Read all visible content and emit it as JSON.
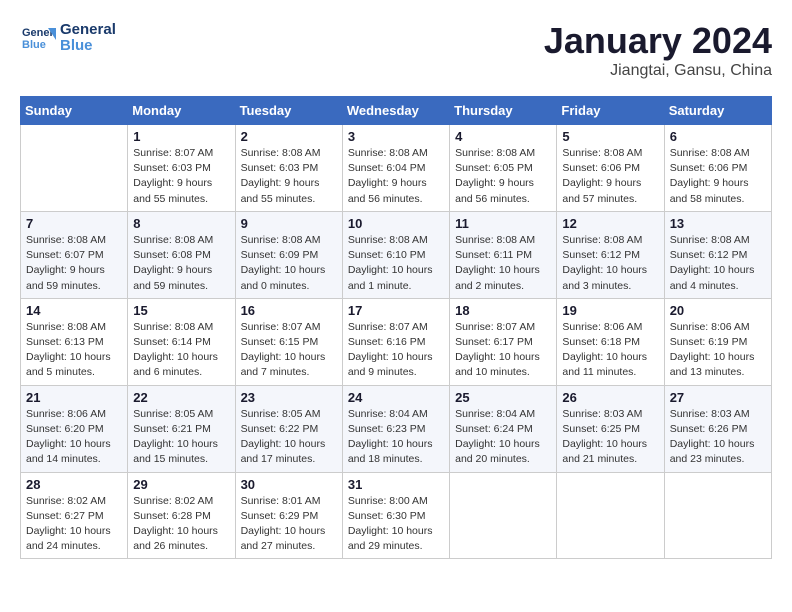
{
  "header": {
    "logo_line1": "General",
    "logo_line2": "Blue",
    "month": "January 2024",
    "location": "Jiangtai, Gansu, China"
  },
  "weekdays": [
    "Sunday",
    "Monday",
    "Tuesday",
    "Wednesday",
    "Thursday",
    "Friday",
    "Saturday"
  ],
  "weeks": [
    [
      {
        "day": "",
        "info": ""
      },
      {
        "day": "1",
        "info": "Sunrise: 8:07 AM\nSunset: 6:03 PM\nDaylight: 9 hours\nand 55 minutes."
      },
      {
        "day": "2",
        "info": "Sunrise: 8:08 AM\nSunset: 6:03 PM\nDaylight: 9 hours\nand 55 minutes."
      },
      {
        "day": "3",
        "info": "Sunrise: 8:08 AM\nSunset: 6:04 PM\nDaylight: 9 hours\nand 56 minutes."
      },
      {
        "day": "4",
        "info": "Sunrise: 8:08 AM\nSunset: 6:05 PM\nDaylight: 9 hours\nand 56 minutes."
      },
      {
        "day": "5",
        "info": "Sunrise: 8:08 AM\nSunset: 6:06 PM\nDaylight: 9 hours\nand 57 minutes."
      },
      {
        "day": "6",
        "info": "Sunrise: 8:08 AM\nSunset: 6:06 PM\nDaylight: 9 hours\nand 58 minutes."
      }
    ],
    [
      {
        "day": "7",
        "info": "Sunrise: 8:08 AM\nSunset: 6:07 PM\nDaylight: 9 hours\nand 59 minutes."
      },
      {
        "day": "8",
        "info": "Sunrise: 8:08 AM\nSunset: 6:08 PM\nDaylight: 9 hours\nand 59 minutes."
      },
      {
        "day": "9",
        "info": "Sunrise: 8:08 AM\nSunset: 6:09 PM\nDaylight: 10 hours\nand 0 minutes."
      },
      {
        "day": "10",
        "info": "Sunrise: 8:08 AM\nSunset: 6:10 PM\nDaylight: 10 hours\nand 1 minute."
      },
      {
        "day": "11",
        "info": "Sunrise: 8:08 AM\nSunset: 6:11 PM\nDaylight: 10 hours\nand 2 minutes."
      },
      {
        "day": "12",
        "info": "Sunrise: 8:08 AM\nSunset: 6:12 PM\nDaylight: 10 hours\nand 3 minutes."
      },
      {
        "day": "13",
        "info": "Sunrise: 8:08 AM\nSunset: 6:12 PM\nDaylight: 10 hours\nand 4 minutes."
      }
    ],
    [
      {
        "day": "14",
        "info": "Sunrise: 8:08 AM\nSunset: 6:13 PM\nDaylight: 10 hours\nand 5 minutes."
      },
      {
        "day": "15",
        "info": "Sunrise: 8:08 AM\nSunset: 6:14 PM\nDaylight: 10 hours\nand 6 minutes."
      },
      {
        "day": "16",
        "info": "Sunrise: 8:07 AM\nSunset: 6:15 PM\nDaylight: 10 hours\nand 7 minutes."
      },
      {
        "day": "17",
        "info": "Sunrise: 8:07 AM\nSunset: 6:16 PM\nDaylight: 10 hours\nand 9 minutes."
      },
      {
        "day": "18",
        "info": "Sunrise: 8:07 AM\nSunset: 6:17 PM\nDaylight: 10 hours\nand 10 minutes."
      },
      {
        "day": "19",
        "info": "Sunrise: 8:06 AM\nSunset: 6:18 PM\nDaylight: 10 hours\nand 11 minutes."
      },
      {
        "day": "20",
        "info": "Sunrise: 8:06 AM\nSunset: 6:19 PM\nDaylight: 10 hours\nand 13 minutes."
      }
    ],
    [
      {
        "day": "21",
        "info": "Sunrise: 8:06 AM\nSunset: 6:20 PM\nDaylight: 10 hours\nand 14 minutes."
      },
      {
        "day": "22",
        "info": "Sunrise: 8:05 AM\nSunset: 6:21 PM\nDaylight: 10 hours\nand 15 minutes."
      },
      {
        "day": "23",
        "info": "Sunrise: 8:05 AM\nSunset: 6:22 PM\nDaylight: 10 hours\nand 17 minutes."
      },
      {
        "day": "24",
        "info": "Sunrise: 8:04 AM\nSunset: 6:23 PM\nDaylight: 10 hours\nand 18 minutes."
      },
      {
        "day": "25",
        "info": "Sunrise: 8:04 AM\nSunset: 6:24 PM\nDaylight: 10 hours\nand 20 minutes."
      },
      {
        "day": "26",
        "info": "Sunrise: 8:03 AM\nSunset: 6:25 PM\nDaylight: 10 hours\nand 21 minutes."
      },
      {
        "day": "27",
        "info": "Sunrise: 8:03 AM\nSunset: 6:26 PM\nDaylight: 10 hours\nand 23 minutes."
      }
    ],
    [
      {
        "day": "28",
        "info": "Sunrise: 8:02 AM\nSunset: 6:27 PM\nDaylight: 10 hours\nand 24 minutes."
      },
      {
        "day": "29",
        "info": "Sunrise: 8:02 AM\nSunset: 6:28 PM\nDaylight: 10 hours\nand 26 minutes."
      },
      {
        "day": "30",
        "info": "Sunrise: 8:01 AM\nSunset: 6:29 PM\nDaylight: 10 hours\nand 27 minutes."
      },
      {
        "day": "31",
        "info": "Sunrise: 8:00 AM\nSunset: 6:30 PM\nDaylight: 10 hours\nand 29 minutes."
      },
      {
        "day": "",
        "info": ""
      },
      {
        "day": "",
        "info": ""
      },
      {
        "day": "",
        "info": ""
      }
    ]
  ]
}
